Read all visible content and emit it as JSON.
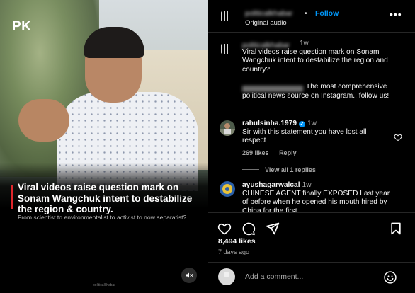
{
  "media": {
    "brand": "PK",
    "headline": "Viral videos raise question mark on Sonam Wangchuk intent to destabilize the region & country.",
    "subtext": "From scientist to environmentalist to activist to now separatist?",
    "watermark": "politicalkhabar",
    "mute_icon": "speaker-muted-icon"
  },
  "post_header": {
    "username": "politicalkhabar",
    "dot": "•",
    "follow_label": "Follow",
    "audio": "Original audio",
    "more_icon": "more-horizontal-icon",
    "more_glyph": "•••"
  },
  "caption": {
    "username": "politicalkhabar",
    "time": "1w",
    "line1": "Viral videos raise question mark on Sonam Wangchuk intent to destabilize the region and country?",
    "line2_handle": "politicalkhabar",
    "line2": "The most comprehensive political news source on Instagram.. follow us!"
  },
  "comments": [
    {
      "username": "rahulsinha.1979",
      "verified": true,
      "time": "1w",
      "text": "Sir with this statement you have lost all respect",
      "likes": "269 likes",
      "reply": "Reply"
    },
    {
      "username": "ayushagarwalcal",
      "verified": false,
      "time": "1w",
      "text": "CHINESE AGENT finally EXPOSED Last year of before when he opened his mouth hired by China for the first"
    }
  ],
  "view_replies": "View all 1 replies",
  "actions": {
    "like_icon": "heart-icon",
    "comment_icon": "comment-icon",
    "share_icon": "send-icon",
    "save_icon": "bookmark-icon",
    "likes": "8,494 likes",
    "ago": "7 days ago"
  },
  "add_comment": {
    "placeholder": "Add a comment...",
    "emoji_icon": "emoji-icon"
  },
  "colors": {
    "accent": "#0095f6",
    "headline_bar": "#e0262b",
    "background": "#000000"
  }
}
